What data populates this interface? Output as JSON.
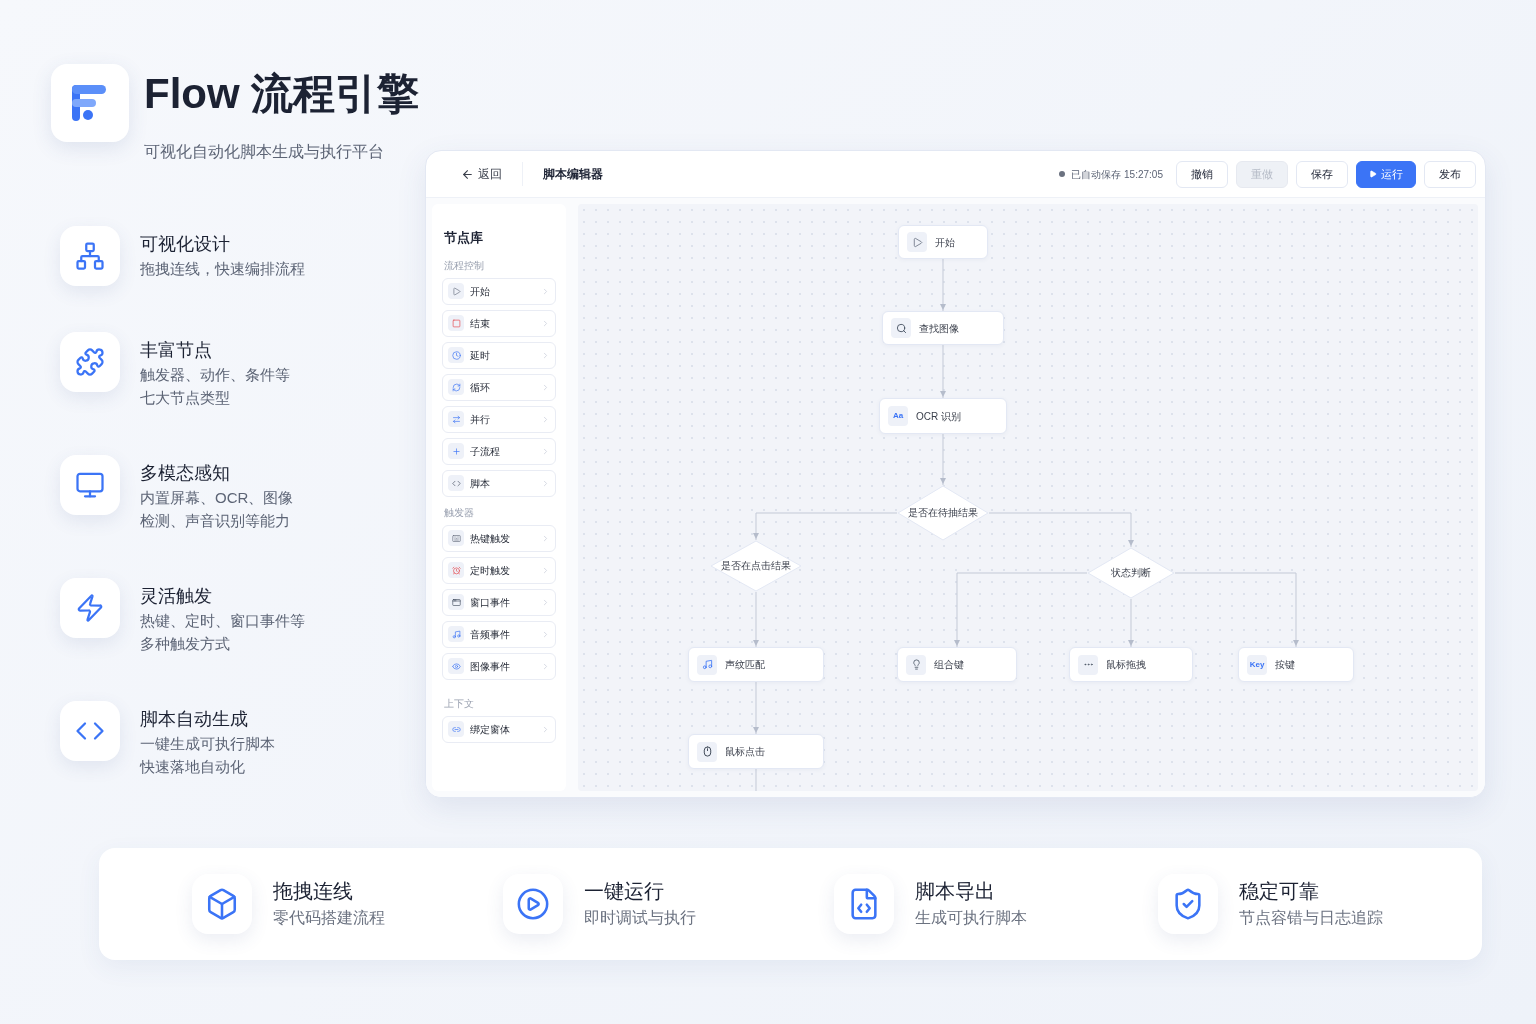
{
  "brand": {
    "title": "Flow 流程引擎",
    "subtitle": "可视化自动化脚本生成与执行平台"
  },
  "features": [
    {
      "title": "可视化设计",
      "lines": [
        "拖拽连线，快速编排流程"
      ]
    },
    {
      "title": "丰富节点",
      "lines": [
        "触发器、动作、条件等",
        "七大节点类型"
      ]
    },
    {
      "title": "多模态感知",
      "lines": [
        "内置屏幕、OCR、图像",
        "检测、声音识别等能力"
      ]
    },
    {
      "title": "灵活触发",
      "lines": [
        "热键、定时、窗口事件等",
        "多种触发方式"
      ]
    },
    {
      "title": "脚本自动生成",
      "lines": [
        "一键生成可执行脚本",
        "快速落地自动化"
      ]
    }
  ],
  "editor": {
    "back": "返回",
    "title": "脚本编辑器",
    "autosave": "已自动保存 15:27:05",
    "buttons": [
      {
        "label": "撤销",
        "kind": "plain",
        "disabled": false
      },
      {
        "label": "重做",
        "kind": "plain",
        "disabled": true
      },
      {
        "label": "保存",
        "kind": "plain",
        "disabled": false
      },
      {
        "label": "运行",
        "kind": "primary",
        "disabled": false
      },
      {
        "label": "发布",
        "kind": "plain",
        "disabled": false
      }
    ],
    "library": {
      "title": "节点库",
      "sections": [
        {
          "title": "流程控制",
          "items": [
            {
              "label": "开始"
            },
            {
              "label": "结束"
            },
            {
              "label": "延时"
            },
            {
              "label": "循环"
            },
            {
              "label": "并行"
            },
            {
              "label": "子流程"
            },
            {
              "label": "脚本"
            }
          ]
        },
        {
          "title": "触发器",
          "items": [
            {
              "label": "热键触发"
            },
            {
              "label": "定时触发"
            },
            {
              "label": "窗口事件"
            },
            {
              "label": "音频事件"
            },
            {
              "label": "图像事件"
            }
          ]
        },
        {
          "title": "上下文",
          "items": [
            {
              "label": "绑定窗体"
            }
          ]
        }
      ]
    },
    "flow": {
      "nodes": [
        {
          "kind": "box",
          "label": "开始"
        },
        {
          "kind": "box",
          "label": "查找图像"
        },
        {
          "kind": "box",
          "badge": "Aa",
          "label": "OCR 识别"
        },
        {
          "kind": "decision",
          "label": "是否在待抽结果"
        },
        {
          "kind": "decision",
          "label": "是否在点击结果"
        },
        {
          "kind": "decision",
          "label": "状态判断"
        },
        {
          "kind": "box",
          "label": "声纹匹配"
        },
        {
          "kind": "box",
          "label": "组合键"
        },
        {
          "kind": "box",
          "label": "鼠标拖拽"
        },
        {
          "kind": "box",
          "badge": "Key",
          "label": "按键"
        },
        {
          "kind": "box",
          "label": "鼠标点击"
        }
      ]
    }
  },
  "highlights": [
    {
      "title": "拖拽连线",
      "subtitle": "零代码搭建流程"
    },
    {
      "title": "一键运行",
      "subtitle": "即时调试与执行"
    },
    {
      "title": "脚本导出",
      "subtitle": "生成可执行脚本"
    },
    {
      "title": "稳定可靠",
      "subtitle": "节点容错与日志追踪"
    }
  ]
}
